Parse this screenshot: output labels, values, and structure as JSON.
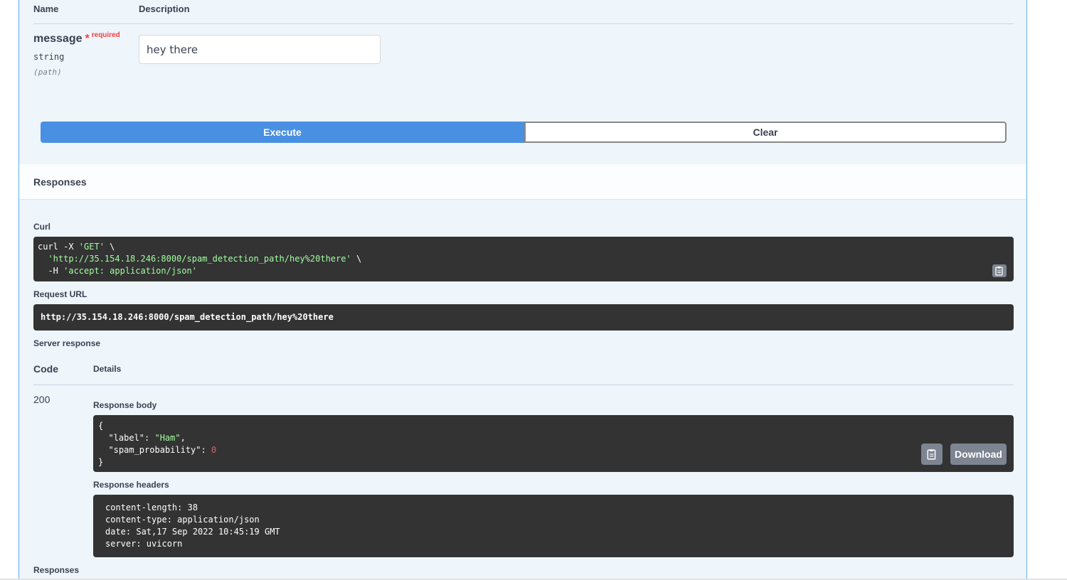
{
  "parameters": {
    "header_name": "Name",
    "header_description": "Description",
    "param": {
      "name": "message",
      "star": "*",
      "required": "required",
      "type": "string",
      "in": "(path)",
      "value": "hey there"
    }
  },
  "actions": {
    "execute_label": "Execute",
    "clear_label": "Clear"
  },
  "responses_section_title": "Responses",
  "curl": {
    "label": "Curl",
    "line1_cmd": "curl -X ",
    "line1_method": "'GET'",
    "line1_tail": " \\",
    "line2_url": "'http://35.154.18.246:8000/spam_detection_path/hey%20there'",
    "line2_tail": " \\",
    "line3_flag": "  -H ",
    "line3_header": "'accept: application/json'"
  },
  "request_url": {
    "label": "Request URL",
    "value": "http://35.154.18.246:8000/spam_detection_path/hey%20there"
  },
  "server_response": {
    "label": "Server response",
    "code_header": "Code",
    "details_header": "Details",
    "status_code": "200",
    "body_label": "Response body",
    "body": {
      "open": "{",
      "key1": "\"label\"",
      "val1": "\"Ham\"",
      "key2": "\"spam_probability\"",
      "val2": "0",
      "close": "}"
    },
    "download_label": "Download",
    "headers_label": "Response headers",
    "headers": [
      "content-length: 38",
      "content-type: application/json",
      "date: Sat,17 Sep 2022 10:45:19 GMT",
      "server: uvicorn"
    ]
  },
  "responses_bottom_label": "Responses",
  "icons": {
    "copy": "clipboard-icon"
  },
  "colors": {
    "execute": "#4990e2",
    "panel_bg": "#eef5fb",
    "panel_border": "#61affe",
    "code_bg": "#333333",
    "string": "#a2fca2",
    "number": "#d36363",
    "required": "#f93e3e"
  }
}
